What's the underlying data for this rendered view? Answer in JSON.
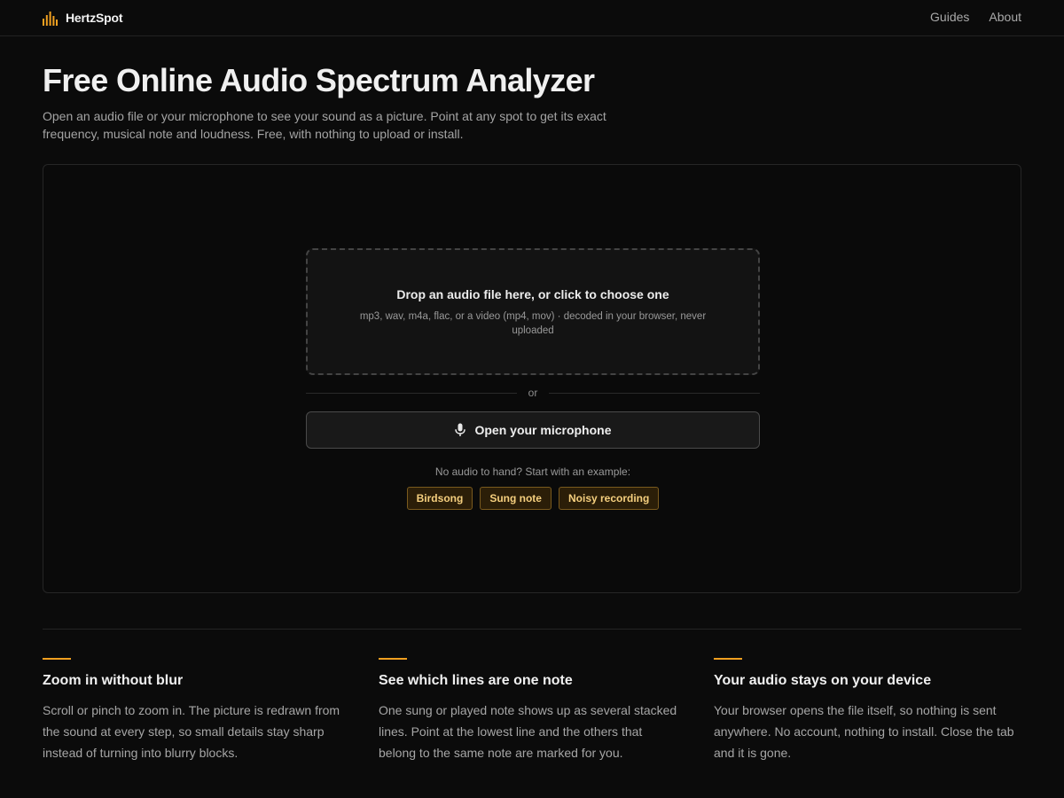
{
  "brand": {
    "name": "HertzSpot",
    "icon": "bars-logo-icon",
    "accent": "#f0a020"
  },
  "nav": {
    "items": [
      "Guides",
      "About"
    ]
  },
  "hero": {
    "title": "Free Online Audio Spectrum Analyzer",
    "intro": "Open an audio file or your microphone to see your sound as a picture. Point at any spot to get its exact frequency, musical note and loudness. Free, with nothing to upload or install."
  },
  "panel": {
    "dropzone": {
      "title": "Drop an audio file here, or click to choose one",
      "subtitle": "mp3, wav, m4a, flac, or a video (mp4, mov) · decoded in your browser, never uploaded"
    },
    "or_label": "or",
    "mic_button": {
      "label": "Open your microphone",
      "icon": "microphone-icon"
    },
    "examples_label": "No audio to hand? Start with an example:",
    "examples": [
      "Birdsong",
      "Sung note",
      "Noisy recording"
    ]
  },
  "features": [
    {
      "title": "Zoom in without blur",
      "body": "Scroll or pinch to zoom in. The picture is redrawn from the sound at every step, so small details stay sharp instead of turning into blurry blocks."
    },
    {
      "title": "See which lines are one note",
      "body": "One sung or played note shows up as several stacked lines. Point at the lowest line and the others that belong to the same note are marked for you."
    },
    {
      "title": "Your audio stays on your device",
      "body": "Your browser opens the file itself, so nothing is sent anywhere. No account, nothing to install. Close the tab and it is gone."
    }
  ]
}
